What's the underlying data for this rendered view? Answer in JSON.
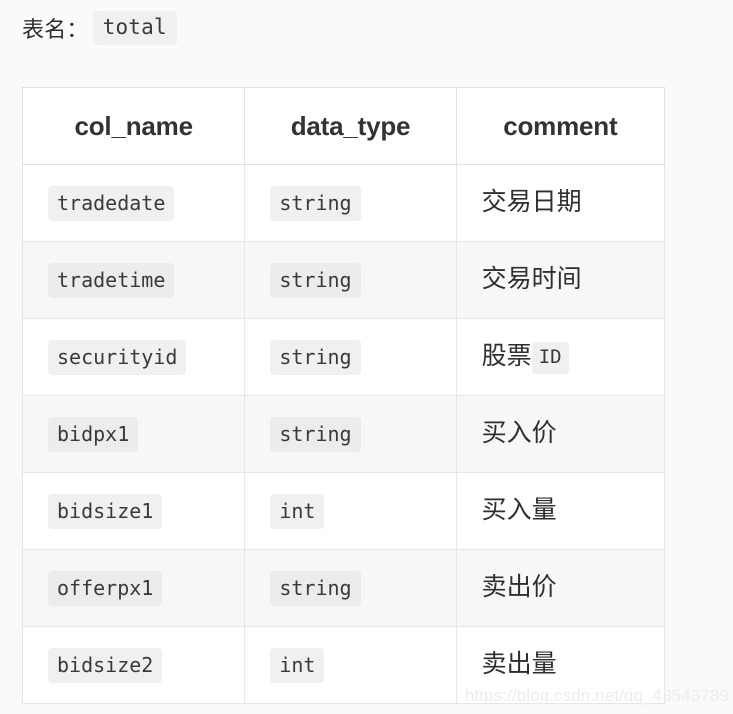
{
  "page": {
    "background_color": "#fafafa",
    "watermark": "https://blog.csdn.net/qq_43543789"
  },
  "header": {
    "label": "表名：",
    "table_name": "total"
  },
  "table": {
    "columns": [
      "col_name",
      "data_type",
      "comment"
    ],
    "rows": [
      {
        "col_name": "tradedate",
        "data_type": "string",
        "comment_text": "交易日期",
        "comment_code": ""
      },
      {
        "col_name": "tradetime",
        "data_type": "string",
        "comment_text": "交易时间",
        "comment_code": ""
      },
      {
        "col_name": "securityid",
        "data_type": "string",
        "comment_text": "股票",
        "comment_code": "ID"
      },
      {
        "col_name": "bidpx1",
        "data_type": "string",
        "comment_text": "买入价",
        "comment_code": ""
      },
      {
        "col_name": "bidsize1",
        "data_type": "int",
        "comment_text": "买入量",
        "comment_code": ""
      },
      {
        "col_name": "offerpx1",
        "data_type": "string",
        "comment_text": "卖出价",
        "comment_code": ""
      },
      {
        "col_name": "bidsize2",
        "data_type": "int",
        "comment_text": "卖出量",
        "comment_code": ""
      }
    ]
  },
  "colors": {
    "code_badge_bg": "#f0f0f0",
    "code_badge_bg_striped": "#ececec",
    "border": "#e0e0e0",
    "header_text": "#333333",
    "body_text": "#2f2f2f",
    "stripe_row_bg": "#f7f7f7",
    "watermark": "#ededed"
  }
}
